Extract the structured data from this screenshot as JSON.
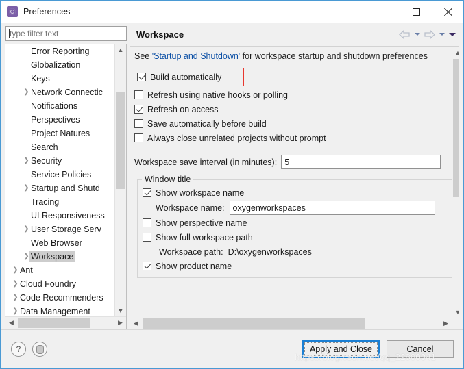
{
  "window": {
    "title": "Preferences",
    "icon": "preferences-gear-icon",
    "controls": {
      "minimize": "minimize-icon",
      "maximize": "maximize-icon",
      "close": "close-icon"
    }
  },
  "filter": {
    "value": "",
    "placeholder": "type filter text"
  },
  "tree": {
    "items": [
      {
        "label": "Error Reporting",
        "depth": 1,
        "expandable": false,
        "selected": false
      },
      {
        "label": "Globalization",
        "depth": 1,
        "expandable": false,
        "selected": false
      },
      {
        "label": "Keys",
        "depth": 1,
        "expandable": false,
        "selected": false
      },
      {
        "label": "Network Connectic",
        "depth": 1,
        "expandable": true,
        "selected": false
      },
      {
        "label": "Notifications",
        "depth": 1,
        "expandable": false,
        "selected": false
      },
      {
        "label": "Perspectives",
        "depth": 1,
        "expandable": false,
        "selected": false
      },
      {
        "label": "Project Natures",
        "depth": 1,
        "expandable": false,
        "selected": false
      },
      {
        "label": "Search",
        "depth": 1,
        "expandable": false,
        "selected": false
      },
      {
        "label": "Security",
        "depth": 1,
        "expandable": true,
        "selected": false
      },
      {
        "label": "Service Policies",
        "depth": 1,
        "expandable": false,
        "selected": false
      },
      {
        "label": "Startup and Shutd",
        "depth": 1,
        "expandable": true,
        "selected": false
      },
      {
        "label": "Tracing",
        "depth": 1,
        "expandable": false,
        "selected": false
      },
      {
        "label": "UI Responsiveness",
        "depth": 1,
        "expandable": false,
        "selected": false
      },
      {
        "label": "User Storage Serv",
        "depth": 1,
        "expandable": true,
        "selected": false
      },
      {
        "label": "Web Browser",
        "depth": 1,
        "expandable": false,
        "selected": false
      },
      {
        "label": "Workspace",
        "depth": 1,
        "expandable": true,
        "selected": true
      },
      {
        "label": "Ant",
        "depth": 0,
        "expandable": true,
        "selected": false
      },
      {
        "label": "Cloud Foundry",
        "depth": 0,
        "expandable": true,
        "selected": false
      },
      {
        "label": "Code Recommenders",
        "depth": 0,
        "expandable": true,
        "selected": false
      },
      {
        "label": "Data Management",
        "depth": 0,
        "expandable": true,
        "selected": false
      }
    ],
    "scroll_up_icon": "chevron-up-icon",
    "scroll_down_icon": "chevron-down-icon",
    "scroll_left_icon": "chevron-left-icon",
    "scroll_right_icon": "chevron-right-icon"
  },
  "page": {
    "title": "Workspace",
    "nav": {
      "back_icon": "back-arrow-icon",
      "back_menu_icon": "chevron-down-icon",
      "forward_icon": "forward-arrow-icon",
      "forward_menu_icon": "chevron-down-icon",
      "view_menu_icon": "chevron-down-icon"
    },
    "description": {
      "prefix": "See ",
      "link": "'Startup and Shutdown'",
      "suffix": " for workspace startup and shutdown preferences"
    },
    "checkboxes": [
      {
        "label": "Build automatically",
        "checked": true,
        "highlighted": true
      },
      {
        "label": "Refresh using native hooks or polling",
        "checked": false,
        "highlighted": false
      },
      {
        "label": "Refresh on access",
        "checked": true,
        "highlighted": false
      },
      {
        "label": "Save automatically before build",
        "checked": false,
        "highlighted": false
      },
      {
        "label": "Always close unrelated projects without prompt",
        "checked": false,
        "highlighted": false
      }
    ],
    "save_interval": {
      "label": "Workspace save interval (in minutes):",
      "value": "5"
    },
    "window_title_group": {
      "title": "Window title",
      "show_workspace_name": {
        "label": "Show workspace name",
        "checked": true
      },
      "workspace_name": {
        "label": "Workspace name:",
        "value": "oxygenworkspaces"
      },
      "show_perspective_name": {
        "label": "Show perspective name",
        "checked": false
      },
      "show_full_workspace_path": {
        "label": "Show full workspace path",
        "checked": false
      },
      "workspace_path": {
        "label": "Workspace path:",
        "value": "D:\\oxygenworkspaces"
      },
      "show_product_name": {
        "label": "Show product name",
        "checked": true
      }
    }
  },
  "footer": {
    "help_icon": "help-question-icon",
    "restore_icon": "restore-defaults-icon",
    "apply_and_close": "Apply and Close",
    "cancel": "Cancel"
  },
  "watermark": "https://blog.csdn.net/qq_22880341",
  "colors": {
    "accent": "#1a7fd4",
    "highlight": "#e8372f",
    "link": "#0b4fa5",
    "window_bg": "#f0f0f0",
    "selection": "#cdcdcd"
  }
}
